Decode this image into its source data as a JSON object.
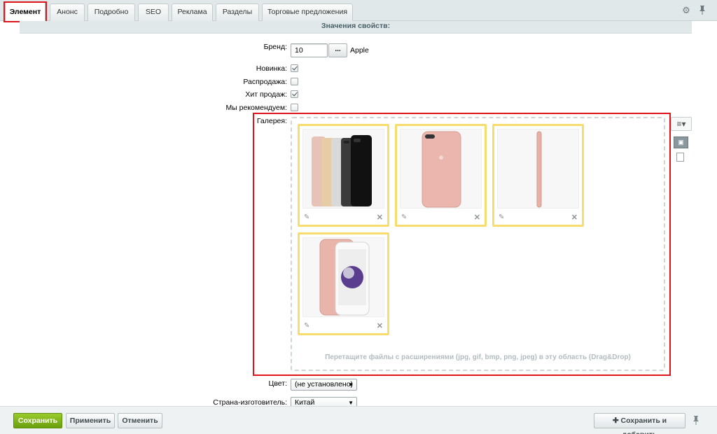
{
  "tabs": [
    {
      "label": "Элемент",
      "active": true
    },
    {
      "label": "Анонс"
    },
    {
      "label": "Подробно"
    },
    {
      "label": "SEO"
    },
    {
      "label": "Реклама"
    },
    {
      "label": "Разделы"
    },
    {
      "label": "Торговые предложения"
    }
  ],
  "toolbar_icons": {
    "settings": "gear-icon",
    "pin": "pin-icon"
  },
  "section_title": "Значения свойств:",
  "fields": {
    "brand": {
      "label": "Бренд:",
      "value": "10",
      "button": "...",
      "name": "Apple"
    },
    "novelty": {
      "label": "Новинка:",
      "checked": true
    },
    "sale": {
      "label": "Распродажа:",
      "checked": false
    },
    "bestseller": {
      "label": "Хит продаж:",
      "checked": true
    },
    "recommended": {
      "label": "Мы рекомендуем:",
      "checked": false
    },
    "gallery": {
      "label": "Галерея:",
      "drop_text": "Перетащите файлы с расширениями (jpg, gif, bmp, png, jpeg) в эту область (Drag&Drop)",
      "images": [
        "iphone-lineup-photo",
        "iphone-back-rose-photo",
        "iphone-side-rose-photo",
        "iphone-front-back-rose-photo"
      ]
    },
    "color": {
      "label": "Цвет:",
      "value": "(не установлено)"
    },
    "country": {
      "label": "Страна-изготовитель:",
      "value": "Китай"
    }
  },
  "highlight_color": "#e0151b",
  "footer": {
    "save": "Сохранить",
    "apply": "Применить",
    "cancel": "Отменить",
    "save_add": "Сохранить и добавить"
  }
}
